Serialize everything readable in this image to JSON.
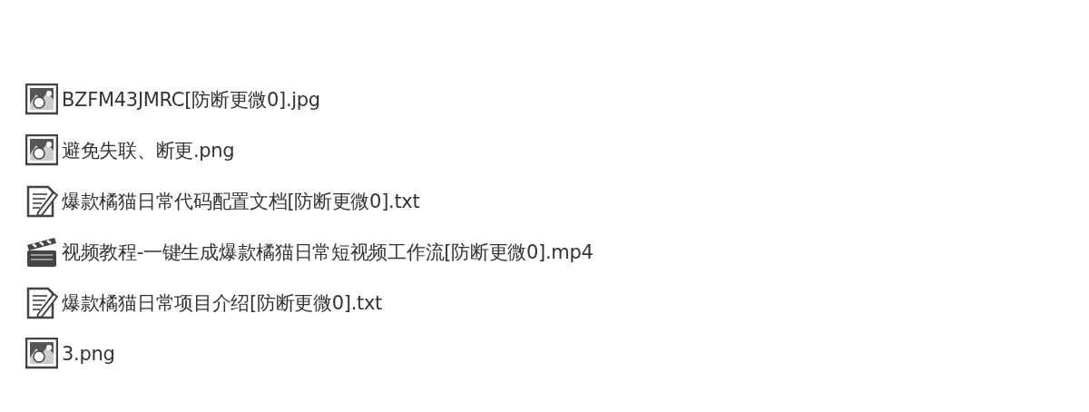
{
  "files": [
    {
      "kind": "image",
      "name": "BZFM43JMRC[防断更微0].jpg"
    },
    {
      "kind": "image",
      "name": "避免失联、断更.png"
    },
    {
      "kind": "text",
      "name": "爆款橘猫日常代码配置文档[防断更微0].txt"
    },
    {
      "kind": "video",
      "name": "视频教程-一键生成爆款橘猫日常短视频工作流[防断更微0].mp4"
    },
    {
      "kind": "text",
      "name": "爆款橘猫日常项目介绍[防断更微0].txt"
    },
    {
      "kind": "image",
      "name": "3.png"
    }
  ]
}
